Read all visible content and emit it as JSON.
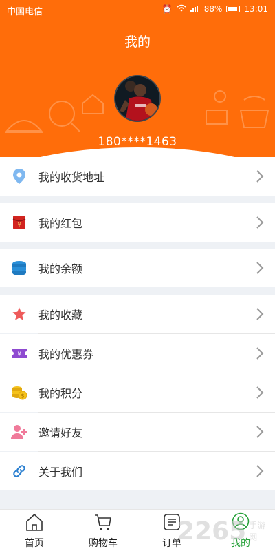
{
  "status_bar": {
    "carrier": "中国电信",
    "battery": "88%",
    "time": "13:01"
  },
  "header": {
    "title": "我的",
    "phone": "180****1463"
  },
  "menu": {
    "address": "我的收货地址",
    "redpacket": "我的红包",
    "balance": "我的余额",
    "favorites": "我的收藏",
    "coupons": "我的优惠券",
    "points": "我的积分",
    "invite": "邀请好友",
    "about": "关于我们"
  },
  "tabs": {
    "home": "首页",
    "cart": "购物车",
    "orders": "订单",
    "me": "我的"
  },
  "watermark": {
    "number": "2265",
    "text": "手游网"
  },
  "colors": {
    "header": "#ff6d0a",
    "active_tab": "#27a13a",
    "background": "#eef1f5"
  }
}
